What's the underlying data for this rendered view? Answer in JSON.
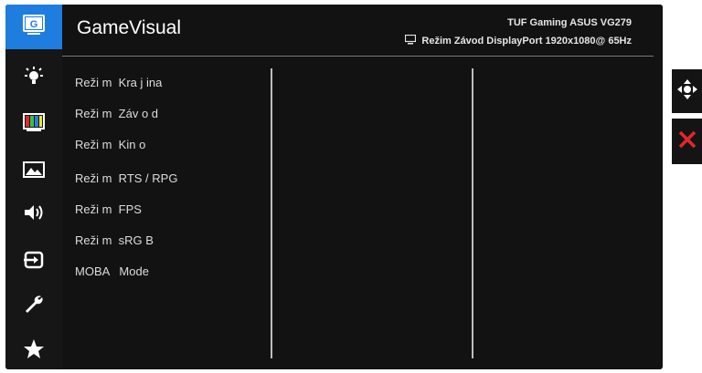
{
  "header": {
    "title": "GameVisual",
    "model": "TUF Gaming ASUS VG279",
    "status_text": "Režim Závod DisplayPort 1920x1080@ 65Hz"
  },
  "menu": {
    "items": [
      {
        "label": "Reži m  Kra j ina"
      },
      {
        "label": "Reži m  Záv o d"
      },
      {
        "label": "Reži m  Kin o"
      },
      {
        "label": "Reži m  RTS / RPG"
      },
      {
        "label": "Reži m  FPS"
      },
      {
        "label": "Reži m  sRG B"
      },
      {
        "label": "MOBA   Mode"
      }
    ]
  },
  "sidebar": {
    "items": [
      {
        "icon": "gamevisual-icon",
        "active": true
      },
      {
        "icon": "brightness-icon"
      },
      {
        "icon": "color-icon"
      },
      {
        "icon": "image-icon"
      },
      {
        "icon": "sound-icon"
      },
      {
        "icon": "input-select-icon"
      },
      {
        "icon": "system-setup-icon"
      },
      {
        "icon": "favorite-star-icon"
      }
    ]
  },
  "nav_buttons": {
    "navigate_icon": "navigate-icon",
    "close_icon": "close-icon"
  },
  "colors": {
    "accent": "#1f7ddf",
    "close": "#e3262b",
    "background": "#121212"
  }
}
